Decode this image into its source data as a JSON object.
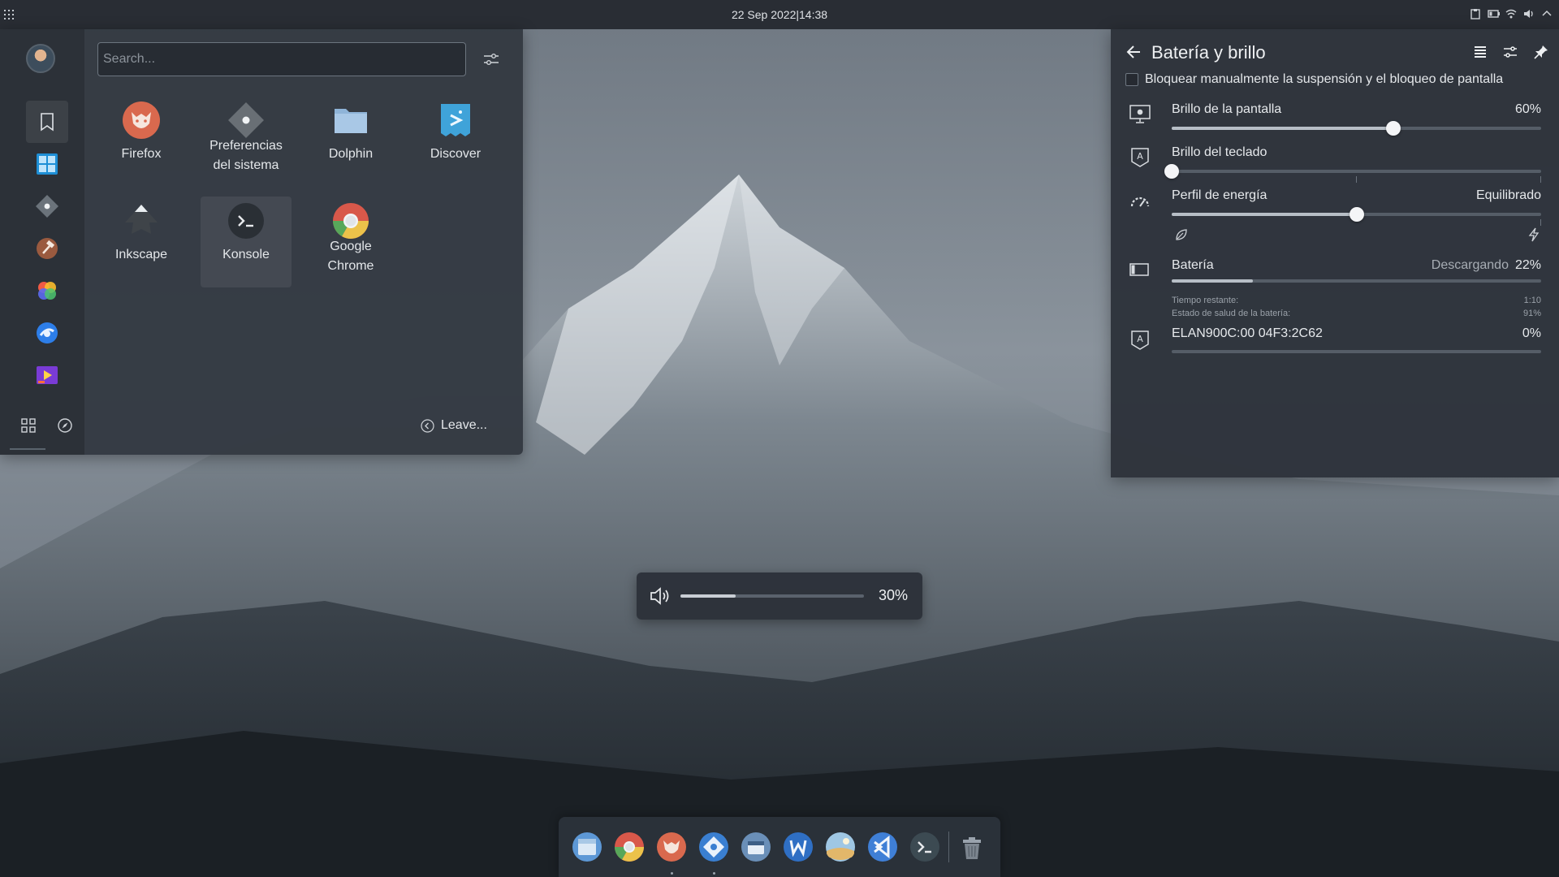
{
  "top_panel": {
    "datetime": "22 Sep 2022|14:38"
  },
  "launcher": {
    "search": {
      "placeholder": "Search...",
      "value": ""
    },
    "apps": [
      {
        "name": "Firefox",
        "line2": ""
      },
      {
        "name": "Preferencias",
        "line2": "del sistema"
      },
      {
        "name": "Dolphin",
        "line2": ""
      },
      {
        "name": "Discover",
        "line2": ""
      },
      {
        "name": "Inkscape",
        "line2": ""
      },
      {
        "name": "Konsole",
        "line2": ""
      },
      {
        "name": "Google",
        "line2": "Chrome"
      }
    ],
    "leave_label": "Leave..."
  },
  "battery_panel": {
    "title": "Batería y brillo",
    "inhibit_label": "Bloquear manualmente la suspensión y el bloqueo de pantalla",
    "screen_brightness": {
      "label": "Brillo de la pantalla",
      "value": "60%",
      "level": 0.6
    },
    "keyboard_brightness": {
      "label": "Brillo del teclado",
      "level": 0.0
    },
    "power_profile": {
      "label": "Perfil de energía",
      "value": "Equilibrado",
      "level": 0.5
    },
    "battery": {
      "label": "Batería",
      "status": "Descargando",
      "percent": "22%",
      "level": 0.22,
      "time_left_label": "Tiempo restante:",
      "time_left_value": "1:10",
      "health_label": "Estado de salud de la batería:",
      "health_value": "91%"
    },
    "device": {
      "label": "ELAN900C:00 04F3:2C62",
      "percent": "0%",
      "level": 0.0
    }
  },
  "volume_osd": {
    "percent": "30%",
    "level": 0.3
  },
  "colors": {
    "panel_bg": "#2d333b",
    "accent_light": "#f4f5f7",
    "firefox_orange": "#d9694e",
    "chrome_red": "#d8584a",
    "vscode_blue": "#3f7fd6"
  },
  "icons": {
    "launcher_rail": [
      "bookmark-icon",
      "windows-grid-icon",
      "settings-diamond-icon",
      "hammer-icon",
      "colors-icon",
      "browser-icon",
      "media-icon"
    ],
    "dock": [
      "finder-icon",
      "chrome-icon",
      "firefox-icon",
      "settings-icon",
      "store-icon",
      "writer-icon",
      "images-icon",
      "vscode-icon",
      "terminal-icon",
      "trash-icon"
    ]
  }
}
